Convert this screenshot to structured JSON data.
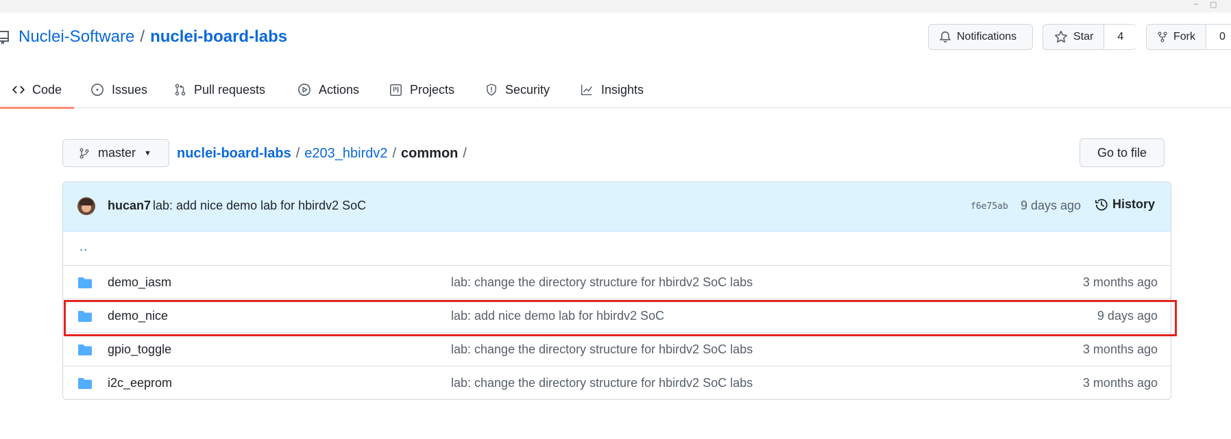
{
  "window": {
    "minimize": "–",
    "maximize": "▢"
  },
  "repo": {
    "owner": "Nuclei-Software",
    "separator": "/",
    "name": "nuclei-board-labs"
  },
  "header_buttons": {
    "notifications_label": "Notifications",
    "star_label": "Star",
    "star_count": "4",
    "fork_label": "Fork",
    "fork_count": "0"
  },
  "tabs": [
    {
      "label": "Code",
      "icon": "code-icon",
      "active": true
    },
    {
      "label": "Issues",
      "icon": "issue-icon"
    },
    {
      "label": "Pull requests",
      "icon": "pull-request-icon"
    },
    {
      "label": "Actions",
      "icon": "play-icon"
    },
    {
      "label": "Projects",
      "icon": "table-icon"
    },
    {
      "label": "Security",
      "icon": "shield-icon"
    },
    {
      "label": "Insights",
      "icon": "graph-icon"
    }
  ],
  "branch": {
    "name": "master"
  },
  "breadcrumb": {
    "repo": "nuclei-board-labs",
    "dir": "e203_hbirdv2",
    "current": "common",
    "sep": "/"
  },
  "goto_file": "Go to file",
  "latest_commit": {
    "author": "hucan7",
    "message": "lab: add nice demo lab for hbirdv2 SoC",
    "sha": "f6e75ab",
    "time": "9 days ago",
    "history_label": "History"
  },
  "parent_dir": "..",
  "files": [
    {
      "name": "demo_iasm",
      "message": "lab: change the directory structure for hbirdv2 SoC labs",
      "time": "3 months ago"
    },
    {
      "name": "demo_nice",
      "message": "lab: add nice demo lab for hbirdv2 SoC",
      "time": "9 days ago",
      "highlighted": true
    },
    {
      "name": "gpio_toggle",
      "message": "lab: change the directory structure for hbirdv2 SoC labs",
      "time": "3 months ago"
    },
    {
      "name": "i2c_eeprom",
      "message": "lab: change the directory structure for hbirdv2 SoC labs",
      "time": "3 months ago"
    }
  ],
  "colors": {
    "link": "#0969da",
    "highlight_border": "#e4231d",
    "commit_bar": "#ddf4ff",
    "folder": "#54aeff",
    "active_tab": "#fd8c73"
  }
}
